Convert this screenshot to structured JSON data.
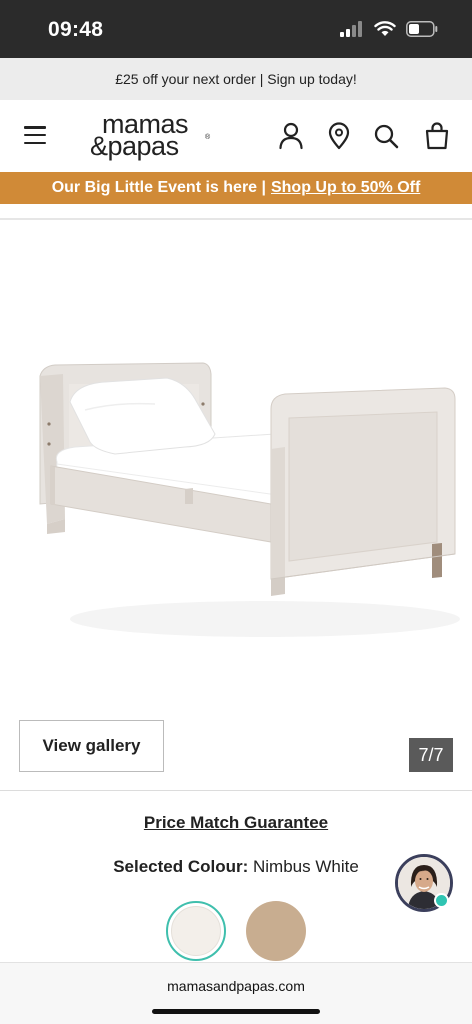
{
  "status_bar": {
    "time": "09:48",
    "signal_icon": "cellular-signal-icon",
    "wifi_icon": "wifi-icon",
    "battery_icon": "battery-icon"
  },
  "promo": {
    "text": "£25 off your next order | Sign up today!"
  },
  "header": {
    "menu_icon": "hamburger-menu-icon",
    "logo_line1": "mamas",
    "logo_line2": "&papas",
    "logo_reg": "®",
    "icons": [
      "account-icon",
      "store-locator-icon",
      "search-icon",
      "shopping-bag-icon"
    ]
  },
  "event_banner": {
    "text": "Our Big Little Event is here |",
    "link": "Shop Up to 50% Off"
  },
  "gallery": {
    "view_gallery_label": "View gallery",
    "counter": "7/7"
  },
  "product": {
    "price_match_label": "Price Match Guarantee",
    "selected_colour_label": "Selected Colour:",
    "selected_colour_value": " Nimbus White",
    "swatches": [
      {
        "name": "Nimbus White",
        "color": "#f3efea",
        "selected": true
      },
      {
        "name": "taupe",
        "color": "#c8ad90",
        "selected": false
      }
    ]
  },
  "chat": {
    "icon": "chat-agent-avatar-icon",
    "status_color": "#2fc4b2"
  },
  "browser": {
    "url": "mamasandpapas.com"
  },
  "colors": {
    "accent_orange": "#d08a37",
    "status_bar_bg": "#2b2b2b",
    "swatch_ring": "#3fbfad"
  }
}
